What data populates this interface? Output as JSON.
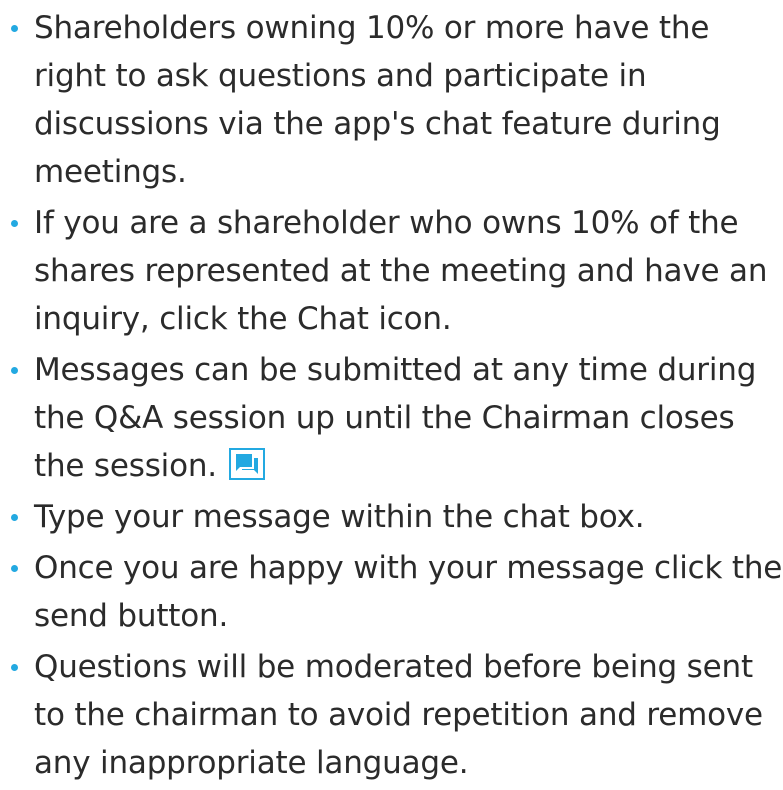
{
  "instructions": {
    "items": [
      {
        "text": "Shareholders owning 10% or more have the right to ask questions and participate in discussions via the app's chat feature during meetings."
      },
      {
        "text": "If you are a shareholder who owns 10% of the shares represented at the meeting and have an inquiry, click the Chat icon."
      },
      {
        "text": "Messages can be submitted at any time during the Q&A session up until the Chairman closes the session.",
        "icon": "chat-icon"
      },
      {
        "text": "Type your message within the chat box."
      },
      {
        "text": "Once you are happy with your message click the send button."
      },
      {
        "text": "Questions will be moderated before being sent to the chairman to avoid repetition and remove any inappropriate language."
      }
    ]
  },
  "colors": {
    "accent": "#23a9e1",
    "text": "#2b2b2b"
  }
}
